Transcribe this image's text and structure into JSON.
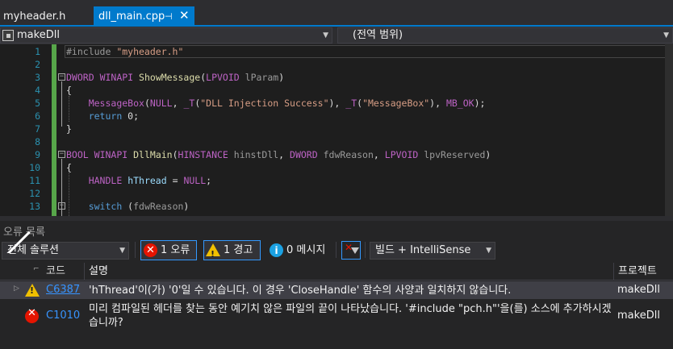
{
  "tabs": [
    {
      "label": "myheader.h",
      "active": false
    },
    {
      "label": "dll_main.cpp",
      "active": true,
      "pin": "⊣",
      "close": "✕"
    }
  ],
  "navbar": {
    "project": "makeDll",
    "scope": "(전역 범위)"
  },
  "editor": {
    "line_numbers": [
      "1",
      "2",
      "3",
      "4",
      "5",
      "6",
      "7",
      "8",
      "9",
      "10",
      "11",
      "12",
      "13"
    ]
  },
  "error_list": {
    "title": "오류 목록",
    "scope_filter": "전체 솔루션",
    "errors_button": "1 오류",
    "warnings_button": "1 경고",
    "messages_button": "0 메시지",
    "source_filter": "빌드 + IntelliSense",
    "columns": {
      "code": "코드",
      "description": "설명",
      "project": "프로젝트"
    },
    "rows": [
      {
        "severity": "warning",
        "code": "C6387",
        "description": "'hThread'이(가) '0'일 수 있습니다.  이 경우 'CloseHandle' 함수의 사양과 일치하지 않습니다.",
        "project": "makeDll"
      },
      {
        "severity": "error",
        "code": "C1010",
        "description": "미리 컴파일된 헤더를 찾는 동안 예기치 않은 파일의 끝이 나타났습니다. '#include \"pch.h\"'을(를) 소스에 추가하시겠습니까?",
        "project": "makeDll"
      }
    ]
  },
  "colors": {
    "accent": "#007acc",
    "error": "#e51400",
    "warning": "#f0c000",
    "link": "#3794ff",
    "line_number": "#2b91af"
  }
}
